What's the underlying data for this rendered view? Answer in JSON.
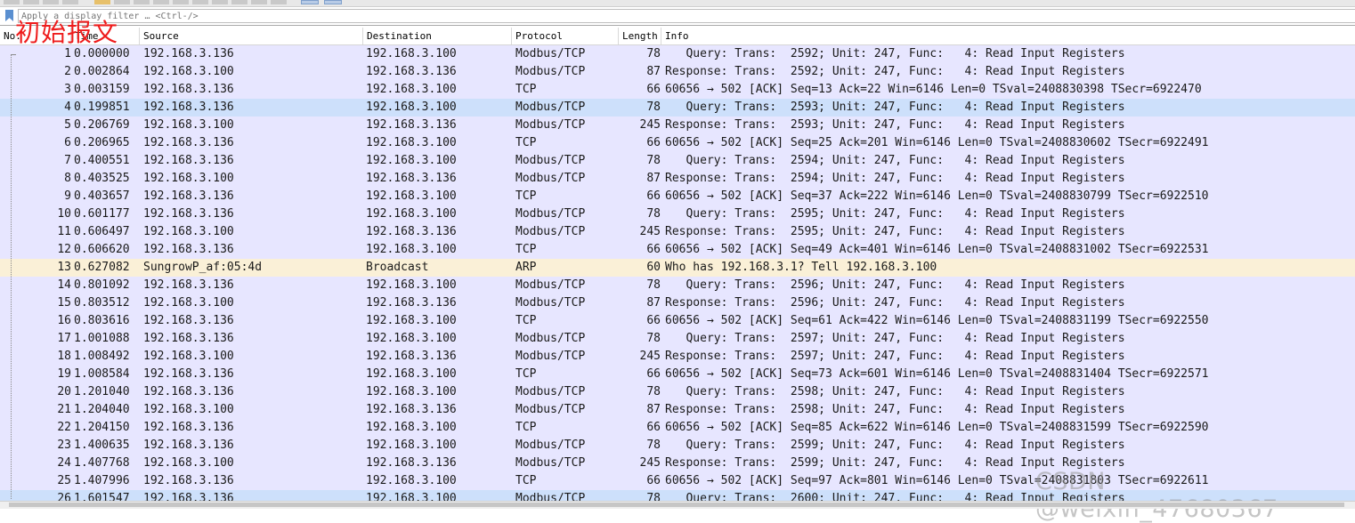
{
  "filter": {
    "placeholder": "Apply a display filter … <Ctrl-/>"
  },
  "columns": {
    "no": "No.",
    "time": "Time",
    "source": "Source",
    "destination": "Destination",
    "protocol": "Protocol",
    "length": "Length",
    "info": "Info"
  },
  "overlay_label": "初始报文",
  "watermark": "CSDN @weixin_47680367",
  "colors": {
    "tcp_row": "#e7e6ff",
    "selected_row": "#cde0fb",
    "arp_row": "#faf0d7",
    "annotation": "#ee1c1c"
  },
  "packets": [
    {
      "no": "1",
      "time": "0.000000",
      "src": "192.168.3.136",
      "dst": "192.168.3.100",
      "proto": "Modbus/TCP",
      "len": "78",
      "info": "   Query: Trans:  2592; Unit: 247, Func:   4: Read Input Registers",
      "style": "tcp"
    },
    {
      "no": "2",
      "time": "0.002864",
      "src": "192.168.3.100",
      "dst": "192.168.3.136",
      "proto": "Modbus/TCP",
      "len": "87",
      "info": "Response: Trans:  2592; Unit: 247, Func:   4: Read Input Registers",
      "style": "tcp"
    },
    {
      "no": "3",
      "time": "0.003159",
      "src": "192.168.3.136",
      "dst": "192.168.3.100",
      "proto": "TCP",
      "len": "66",
      "info": "60656 → 502 [ACK] Seq=13 Ack=22 Win=6146 Len=0 TSval=2408830398 TSecr=6922470",
      "style": "tcp"
    },
    {
      "no": "4",
      "time": "0.199851",
      "src": "192.168.3.136",
      "dst": "192.168.3.100",
      "proto": "Modbus/TCP",
      "len": "78",
      "info": "   Query: Trans:  2593; Unit: 247, Func:   4: Read Input Registers",
      "style": "selected"
    },
    {
      "no": "5",
      "time": "0.206769",
      "src": "192.168.3.100",
      "dst": "192.168.3.136",
      "proto": "Modbus/TCP",
      "len": "245",
      "info": "Response: Trans:  2593; Unit: 247, Func:   4: Read Input Registers",
      "style": "tcp"
    },
    {
      "no": "6",
      "time": "0.206965",
      "src": "192.168.3.136",
      "dst": "192.168.3.100",
      "proto": "TCP",
      "len": "66",
      "info": "60656 → 502 [ACK] Seq=25 Ack=201 Win=6146 Len=0 TSval=2408830602 TSecr=6922491",
      "style": "tcp"
    },
    {
      "no": "7",
      "time": "0.400551",
      "src": "192.168.3.136",
      "dst": "192.168.3.100",
      "proto": "Modbus/TCP",
      "len": "78",
      "info": "   Query: Trans:  2594; Unit: 247, Func:   4: Read Input Registers",
      "style": "tcp"
    },
    {
      "no": "8",
      "time": "0.403525",
      "src": "192.168.3.100",
      "dst": "192.168.3.136",
      "proto": "Modbus/TCP",
      "len": "87",
      "info": "Response: Trans:  2594; Unit: 247, Func:   4: Read Input Registers",
      "style": "tcp"
    },
    {
      "no": "9",
      "time": "0.403657",
      "src": "192.168.3.136",
      "dst": "192.168.3.100",
      "proto": "TCP",
      "len": "66",
      "info": "60656 → 502 [ACK] Seq=37 Ack=222 Win=6146 Len=0 TSval=2408830799 TSecr=6922510",
      "style": "tcp"
    },
    {
      "no": "10",
      "time": "0.601177",
      "src": "192.168.3.136",
      "dst": "192.168.3.100",
      "proto": "Modbus/TCP",
      "len": "78",
      "info": "   Query: Trans:  2595; Unit: 247, Func:   4: Read Input Registers",
      "style": "tcp"
    },
    {
      "no": "11",
      "time": "0.606497",
      "src": "192.168.3.100",
      "dst": "192.168.3.136",
      "proto": "Modbus/TCP",
      "len": "245",
      "info": "Response: Trans:  2595; Unit: 247, Func:   4: Read Input Registers",
      "style": "tcp"
    },
    {
      "no": "12",
      "time": "0.606620",
      "src": "192.168.3.136",
      "dst": "192.168.3.100",
      "proto": "TCP",
      "len": "66",
      "info": "60656 → 502 [ACK] Seq=49 Ack=401 Win=6146 Len=0 TSval=2408831002 TSecr=6922531",
      "style": "tcp"
    },
    {
      "no": "13",
      "time": "0.627082",
      "src": "SungrowP_af:05:4d",
      "dst": "Broadcast",
      "proto": "ARP",
      "len": "60",
      "info": "Who has 192.168.3.1? Tell 192.168.3.100",
      "style": "arp"
    },
    {
      "no": "14",
      "time": "0.801092",
      "src": "192.168.3.136",
      "dst": "192.168.3.100",
      "proto": "Modbus/TCP",
      "len": "78",
      "info": "   Query: Trans:  2596; Unit: 247, Func:   4: Read Input Registers",
      "style": "tcp"
    },
    {
      "no": "15",
      "time": "0.803512",
      "src": "192.168.3.100",
      "dst": "192.168.3.136",
      "proto": "Modbus/TCP",
      "len": "87",
      "info": "Response: Trans:  2596; Unit: 247, Func:   4: Read Input Registers",
      "style": "tcp"
    },
    {
      "no": "16",
      "time": "0.803616",
      "src": "192.168.3.136",
      "dst": "192.168.3.100",
      "proto": "TCP",
      "len": "66",
      "info": "60656 → 502 [ACK] Seq=61 Ack=422 Win=6146 Len=0 TSval=2408831199 TSecr=6922550",
      "style": "tcp"
    },
    {
      "no": "17",
      "time": "1.001088",
      "src": "192.168.3.136",
      "dst": "192.168.3.100",
      "proto": "Modbus/TCP",
      "len": "78",
      "info": "   Query: Trans:  2597; Unit: 247, Func:   4: Read Input Registers",
      "style": "tcp"
    },
    {
      "no": "18",
      "time": "1.008492",
      "src": "192.168.3.100",
      "dst": "192.168.3.136",
      "proto": "Modbus/TCP",
      "len": "245",
      "info": "Response: Trans:  2597; Unit: 247, Func:   4: Read Input Registers",
      "style": "tcp"
    },
    {
      "no": "19",
      "time": "1.008584",
      "src": "192.168.3.136",
      "dst": "192.168.3.100",
      "proto": "TCP",
      "len": "66",
      "info": "60656 → 502 [ACK] Seq=73 Ack=601 Win=6146 Len=0 TSval=2408831404 TSecr=6922571",
      "style": "tcp"
    },
    {
      "no": "20",
      "time": "1.201040",
      "src": "192.168.3.136",
      "dst": "192.168.3.100",
      "proto": "Modbus/TCP",
      "len": "78",
      "info": "   Query: Trans:  2598; Unit: 247, Func:   4: Read Input Registers",
      "style": "tcp"
    },
    {
      "no": "21",
      "time": "1.204040",
      "src": "192.168.3.100",
      "dst": "192.168.3.136",
      "proto": "Modbus/TCP",
      "len": "87",
      "info": "Response: Trans:  2598; Unit: 247, Func:   4: Read Input Registers",
      "style": "tcp"
    },
    {
      "no": "22",
      "time": "1.204150",
      "src": "192.168.3.136",
      "dst": "192.168.3.100",
      "proto": "TCP",
      "len": "66",
      "info": "60656 → 502 [ACK] Seq=85 Ack=622 Win=6146 Len=0 TSval=2408831599 TSecr=6922590",
      "style": "tcp"
    },
    {
      "no": "23",
      "time": "1.400635",
      "src": "192.168.3.136",
      "dst": "192.168.3.100",
      "proto": "Modbus/TCP",
      "len": "78",
      "info": "   Query: Trans:  2599; Unit: 247, Func:   4: Read Input Registers",
      "style": "tcp"
    },
    {
      "no": "24",
      "time": "1.407768",
      "src": "192.168.3.100",
      "dst": "192.168.3.136",
      "proto": "Modbus/TCP",
      "len": "245",
      "info": "Response: Trans:  2599; Unit: 247, Func:   4: Read Input Registers",
      "style": "tcp"
    },
    {
      "no": "25",
      "time": "1.407996",
      "src": "192.168.3.136",
      "dst": "192.168.3.100",
      "proto": "TCP",
      "len": "66",
      "info": "60656 → 502 [ACK] Seq=97 Ack=801 Win=6146 Len=0 TSval=2408831803 TSecr=6922611",
      "style": "tcp"
    },
    {
      "no": "26",
      "time": "1.601547",
      "src": "192.168.3.136",
      "dst": "192.168.3.100",
      "proto": "Modbus/TCP",
      "len": "78",
      "info": "   Query: Trans:  2600; Unit: 247, Func:   4: Read Input Registers",
      "style": "selected"
    }
  ]
}
